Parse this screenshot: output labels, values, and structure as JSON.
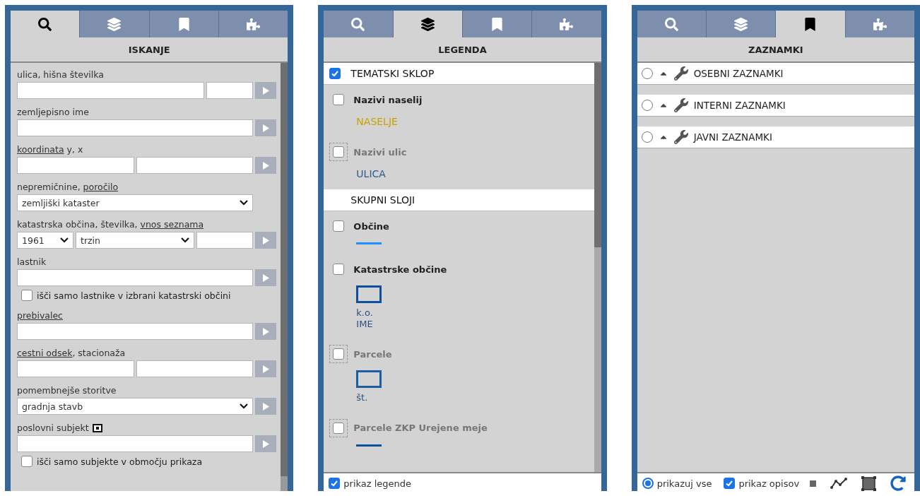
{
  "panels": [
    {
      "kind": "search",
      "title": "ISKANJE",
      "tabs": [
        {
          "selected": true
        },
        {
          "selected": false
        },
        {
          "selected": false
        },
        {
          "selected": false
        }
      ],
      "fields": [
        {
          "kind": "street",
          "label": [
            {
              "text": "ulica, hišna številka",
              "link": false
            }
          ]
        },
        {
          "kind": "single",
          "label": [
            {
              "text": "zemljepisno ime",
              "link": false
            }
          ]
        },
        {
          "kind": "pair",
          "label": [
            {
              "text": "koordinata",
              "link": true
            },
            {
              "text": " y, x",
              "link": false
            }
          ]
        },
        {
          "kind": "select",
          "label": [
            {
              "text": "nepremičnine, ",
              "link": false
            },
            {
              "text": "poročilo",
              "link": true
            }
          ],
          "value": "zemljiški kataster",
          "go": false
        },
        {
          "kind": "cadastre",
          "label": [
            {
              "text": "katastrska občina, številka, ",
              "link": false
            },
            {
              "text": "vnos seznama",
              "link": true
            }
          ],
          "values": [
            "1961",
            "trzin"
          ]
        },
        {
          "kind": "single",
          "label": [
            {
              "text": "lastnik",
              "link": false
            }
          ]
        },
        {
          "kind": "checkbox",
          "text": "išči samo lastnike v izbrani katastrski občini",
          "checked": false
        },
        {
          "kind": "single",
          "label": [
            {
              "text": "prebivalec",
              "link": true
            }
          ]
        },
        {
          "kind": "pair",
          "label": [
            {
              "text": "cestni odsek",
              "link": true
            },
            {
              "text": ", stacionaža",
              "link": false
            }
          ]
        },
        {
          "kind": "select",
          "label": [
            {
              "text": "pomembnejše storitve",
              "link": false
            }
          ],
          "value": "gradnja stavb",
          "go": true
        },
        {
          "kind": "single",
          "label": [
            {
              "text": "poslovni subjekt",
              "link": false
            }
          ],
          "icon": true
        },
        {
          "kind": "checkbox",
          "text": "išči samo subjekte v območju prikaza",
          "checked": false
        }
      ]
    },
    {
      "kind": "legend",
      "title": "LEGENDA",
      "tabs": [
        {
          "selected": false
        },
        {
          "selected": true
        },
        {
          "selected": false
        },
        {
          "selected": false
        }
      ],
      "items": [
        {
          "kind": "group_check",
          "label": "TEMATSKI SKLOP",
          "checked": true
        },
        {
          "kind": "layer",
          "label": "Nazivi naselij",
          "checked": false,
          "disabled": false,
          "symbol": {
            "kind": "text",
            "text": "NASELJE",
            "color": "#c9a200"
          }
        },
        {
          "kind": "layer",
          "label": "Nazivi ulic",
          "checked": false,
          "disabled": true,
          "symbol": {
            "kind": "text",
            "text": "ULICA",
            "color": "#2c5a8e"
          }
        },
        {
          "kind": "group",
          "label": "SKUPNI SLOJI"
        },
        {
          "kind": "layer",
          "label": "Občine",
          "checked": false,
          "disabled": false,
          "symbol": {
            "kind": "line",
            "color": "#1e90ff"
          }
        },
        {
          "kind": "layer",
          "label": "Katastrske občine",
          "checked": false,
          "disabled": false,
          "symbol": {
            "kind": "box",
            "color": "#0d4f9c",
            "caption": [
              "k.o.",
              "IME"
            ]
          }
        },
        {
          "kind": "layer",
          "label": "Parcele",
          "checked": false,
          "disabled": true,
          "symbol": {
            "kind": "box",
            "color": "#1d5da6",
            "caption": [
              "št."
            ]
          }
        },
        {
          "kind": "layer",
          "label": "Parcele ZKP Urejene meje",
          "checked": false,
          "disabled": true,
          "symbol": {
            "kind": "line",
            "color": "#0d4f9c"
          }
        }
      ],
      "footer": {
        "label": "prikaz legende",
        "checked": true
      }
    },
    {
      "kind": "bookmarks",
      "title": "ZAZNAMKI",
      "tabs": [
        {
          "selected": false
        },
        {
          "selected": false
        },
        {
          "selected": true
        },
        {
          "selected": false
        }
      ],
      "groups": [
        {
          "label": "OSEBNI ZAZNAMKI",
          "selected": false
        },
        {
          "label": "INTERNI ZAZNAMKI",
          "selected": false
        },
        {
          "label": "JAVNI ZAZNAMKI",
          "selected": false
        }
      ],
      "footer": {
        "show_all": {
          "label": "prikazuj vse",
          "selected": true
        },
        "descriptions": {
          "label": "prikaz opisov",
          "checked": true
        }
      }
    }
  ]
}
